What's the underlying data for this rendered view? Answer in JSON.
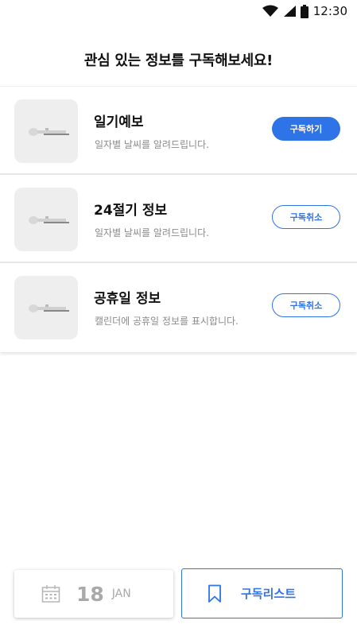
{
  "status_bar": {
    "time": "12:30"
  },
  "page_title": "관심 있는 정보를 구독해보세요!",
  "items": [
    {
      "title": "일기예보",
      "description": "일자별 날씨를 알려드립니다.",
      "button_label": "구독하기",
      "subscribed": false
    },
    {
      "title": "24절기 정보",
      "description": "일자별 날씨를 알려드립니다.",
      "button_label": "구독취소",
      "subscribed": true
    },
    {
      "title": "공휴일 정보",
      "description": "캘린더에 공휴일 정보를 표시합니다.",
      "button_label": "구독취소",
      "subscribed": true
    }
  ],
  "bottom_bar": {
    "date_day": "18",
    "date_month": "JAN",
    "subscription_list_label": "구독리스트"
  },
  "colors": {
    "accent": "#2e74e6",
    "muted": "#8a8a8a"
  },
  "icons": {
    "wifi": "wifi-icon",
    "signal": "signal-icon",
    "battery": "battery-icon",
    "calendar": "calendar-icon",
    "bookmark": "bookmark-icon",
    "thumbnail": "image-placeholder-icon"
  }
}
